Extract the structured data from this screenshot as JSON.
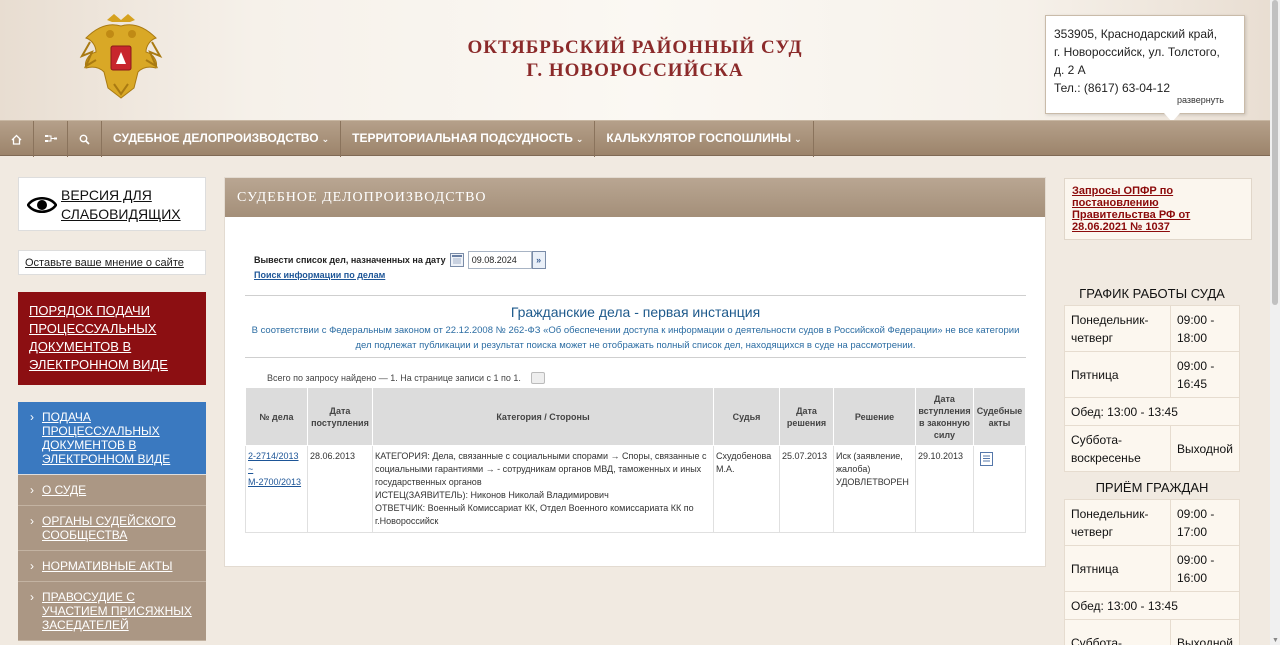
{
  "header": {
    "title_line1": "ОКТЯБРЬСКИЙ РАЙОННЫЙ СУД",
    "title_line2": "Г. НОВОРОССИЙСКА",
    "address_line1": "353905, Краснодарский край,",
    "address_line2": "г. Новороссийск, ул. Толстого,",
    "address_line3": "д. 2 А",
    "phone": "Тел.: (8617) 63-04-12",
    "expand_label": "развернуть"
  },
  "topnav": {
    "icons": [
      "home-icon",
      "sitemap-icon",
      "search-icon"
    ],
    "items": [
      {
        "label": "СУДЕБНОЕ ДЕЛОПРОИЗВОДСТВО"
      },
      {
        "label": "ТЕРРИТОРИАЛЬНАЯ ПОДСУДНОСТЬ"
      },
      {
        "label": "КАЛЬКУЛЯТОР ГОСПОШЛИНЫ"
      }
    ]
  },
  "left": {
    "vis_line1": "ВЕРСИЯ ДЛЯ",
    "vis_line2": "СЛАБОВИДЯЩИХ",
    "feedback": "Оставьте ваше мнение о сайте",
    "red_box": "ПОРЯДОК ПОДАЧИ ПРОЦЕССУАЛЬНЫХ ДОКУМЕНТОВ В ЭЛЕКТРОННОМ ВИДЕ",
    "menu": [
      {
        "label": "ПОДАЧА ПРОЦЕССУАЛЬНЫХ ДОКУМЕНТОВ В ЭЛЕКТРОННОМ ВИДЕ"
      },
      {
        "label": "О СУДЕ"
      },
      {
        "label": "ОРГАНЫ СУДЕЙСКОГО СООБЩЕСТВА"
      },
      {
        "label": "НОРМАТИВНЫЕ АКТЫ"
      },
      {
        "label": "ПРАВОСУДИЕ С УЧАСТИЕМ ПРИСЯЖНЫХ ЗАСЕДАТЕЛЕЙ"
      }
    ]
  },
  "main": {
    "title": "СУДЕБНОЕ ДЕЛОПРОИЗВОДСТВО",
    "date_label": "Вывести список дел, назначенных на дату",
    "date_value": "09.08.2024",
    "go_label": "»",
    "search_link": "Поиск информации по делам",
    "section_title": "Гражданские дела - первая инстанция",
    "section_note": "В соответствии с Федеральным законом от 22.12.2008 № 262-ФЗ «Об обеспечении доступа к информации о деятельности судов в Российской Федерации» не все категории дел подлежат публикации и результат поиска может не отображать полный список дел, находящихся в суде на рассмотрении.",
    "count_text": "Всего по запросу найдено — 1. На странице записи с 1 по 1.",
    "table": {
      "headers": [
        "№ дела",
        "Дата поступления",
        "Категория / Стороны",
        "Судья",
        "Дата решения",
        "Решение",
        "Дата вступления в законную силу",
        "Судебные акты"
      ],
      "row": {
        "case_no_1": "2-2714/2013",
        "case_no_2": "~",
        "case_no_3": "М-2700/2013",
        "received": "28.06.2013",
        "category": "КАТЕГОРИЯ: Дела, связанные с социальными спорами → Споры, связанные с социальными гарантиями → - сотрудникам органов МВД, таможенных и иных государственных органов",
        "plaintiff": "ИСТЕЦ(ЗАЯВИТЕЛЬ): Никонов Николай Владимирович",
        "defendant": "ОТВЕТЧИК: Военный Комиссариат КК, Отдел Военного комиссариата КК по г.Новороссийск",
        "judge": "Схудобенова М.А.",
        "decision_date": "25.07.2013",
        "decision": "Иск (заявление, жалоба) УДОВЛЕТВОРЕН",
        "effective_date": "29.10.2013"
      }
    }
  },
  "right": {
    "opfr": "Запросы ОПФР по постановлению Правительства РФ от 28.06.2021 № 1037",
    "work_title": "ГРАФИК РАБОТЫ СУДА",
    "work": [
      {
        "day": "Понедельник-четверг",
        "time": "09:00 - 18:00"
      },
      {
        "day": "Пятница",
        "time": "09:00 - 16:45"
      },
      {
        "full": "Обед: 13:00 - 13:45"
      },
      {
        "day": "Суббота-воскресенье",
        "time": "Выходной"
      }
    ],
    "reception_title": "ПРИЁМ ГРАЖДАН",
    "reception": [
      {
        "day": "Понедельник-четверг",
        "time": "09:00 - 17:00"
      },
      {
        "day": "Пятница",
        "time": "09:00 - 16:00"
      },
      {
        "full": "Обед: 13:00 - 13:45"
      },
      {
        "day": "Суббота-",
        "time": "Выходной"
      }
    ]
  }
}
